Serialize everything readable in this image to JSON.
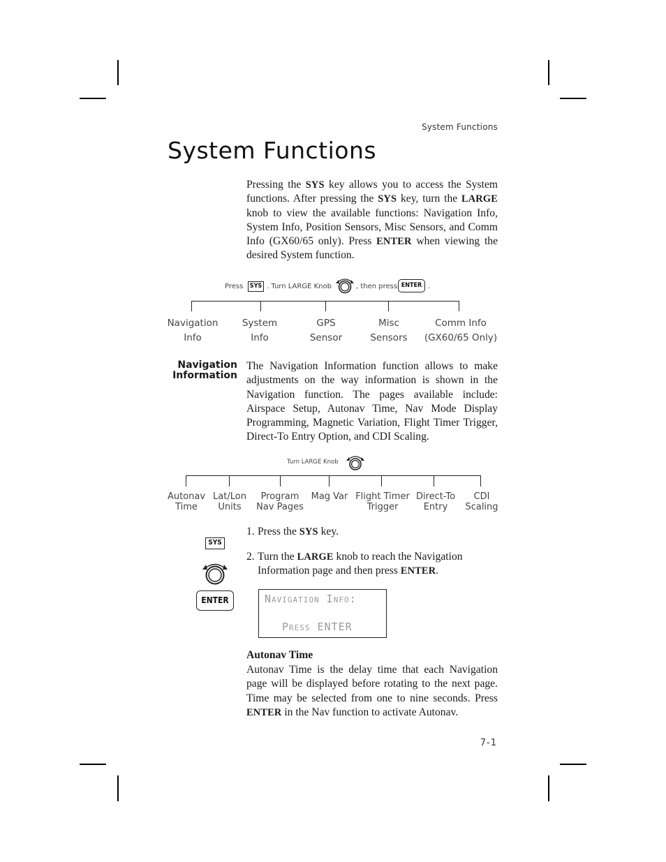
{
  "running_head": "System Functions",
  "page_title": "System Functions",
  "intro": {
    "parts": [
      {
        "t": "Pressing the "
      },
      {
        "k": "SYS"
      },
      {
        "t": " key allows you to access the System functions. After pressing the "
      },
      {
        "k": "SYS"
      },
      {
        "t": " key, turn the "
      },
      {
        "k": "LARGE"
      },
      {
        "t": " knob to view the available functions: Navigation Info, System Info, Position Sensors, Misc Sensors, and Comm Info (GX60/65 only). Press "
      },
      {
        "k": "ENTER"
      },
      {
        "t": " when viewing the desired System function."
      }
    ]
  },
  "diagram1": {
    "instruction": {
      "press": "Press",
      "sys_key": "SYS",
      "turn": ". Turn LARGE Knob",
      "then_press": ", then press",
      "enter_key": "ENTER",
      "end": "."
    },
    "items": [
      {
        "line1": "Navigation",
        "line2": "Info"
      },
      {
        "line1": "System",
        "line2": "Info"
      },
      {
        "line1": "GPS",
        "line2": "Sensor"
      },
      {
        "line1": "Misc",
        "line2": "Sensors"
      },
      {
        "line1": "Comm Info",
        "line2": "(GX60/65 Only)"
      }
    ]
  },
  "nav_info": {
    "side_heading_line1": "Navigation",
    "side_heading_line2": "Information",
    "text": "The Navigation Information function allows to make adjustments on the way information is shown in the Navigation function. The pages available include: Airspace Setup, Autonav Time, Nav Mode Display Programming, Magnetic Variation, Flight Timer Trigger, Direct-To Entry Option, and CDI Scaling."
  },
  "diagram2": {
    "instruction": "Turn LARGE Knob",
    "items": [
      {
        "line1": "Autonav",
        "line2": "Time"
      },
      {
        "line1": "Lat/Lon",
        "line2": "Units"
      },
      {
        "line1": "Program",
        "line2": "Nav Pages"
      },
      {
        "line1": "Mag Var",
        "line2": ""
      },
      {
        "line1": "Flight Timer",
        "line2": "Trigger"
      },
      {
        "line1": "Direct-To",
        "line2": "Entry"
      },
      {
        "line1": "CDI",
        "line2": "Scaling"
      }
    ]
  },
  "steps": {
    "sys_icon_label": "SYS",
    "enter_icon_label": "ENTER",
    "step1": {
      "num": "1.",
      "pre": "Press the ",
      "key": "SYS",
      "post": " key."
    },
    "step2": {
      "num": "2.",
      "pre": "Turn the ",
      "key": "LARGE",
      "mid": " knob to reach the Navigation",
      "line2_pre": "Information page and then press ",
      "key2": "ENTER",
      "line2_post": "."
    }
  },
  "lcd": {
    "line1": "Navigation Info:",
    "line2": "Press ENTER"
  },
  "autonav": {
    "heading": "Autonav Time",
    "text_pre": "Autonav Time is the delay time that each Navigation page will be displayed before rotating to the next page. Time may be selected from one to nine seconds. Press ",
    "key": "ENTER",
    "text_post": " in the Nav function to activate Autonav."
  },
  "page_number": "7-1"
}
